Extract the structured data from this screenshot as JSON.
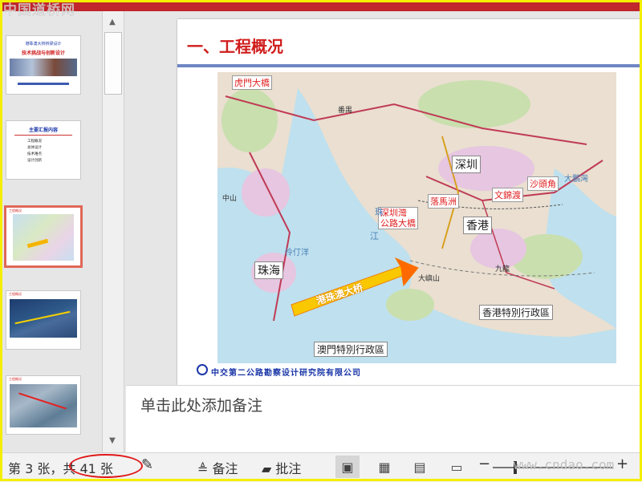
{
  "watermark_top": "中国道桥网",
  "thumbnails": [
    {
      "line1": "港珠澳大桥桥梁设计",
      "line2": "技术挑战与创新设计"
    },
    {
      "heading": "主要汇报内容",
      "bullets": [
        "工程概况",
        "总体设计",
        "技术难点",
        "设计创新"
      ]
    },
    {
      "heading": "工程概况"
    },
    {
      "heading": "工程概况"
    },
    {
      "heading": "工程概况"
    }
  ],
  "slide": {
    "title": "一、工程概况",
    "company": "中交第二公路勘察设计研究院有限公司",
    "map_labels": {
      "humen": "虎門大橋",
      "shenzhen": "深圳",
      "wenjinchu": "文錦渡",
      "shatoujiao": "沙頭角",
      "luomazhou": "落馬洲",
      "shenzhenwan": "深圳灣",
      "gonglu": "公路大橋",
      "xianggang": "香港",
      "zhuhai": "珠海",
      "bridge": "港珠澳大桥",
      "hk_sar": "香港特別行政區",
      "macau_sar": "澳門特別行政區",
      "lingdingyang": "伶仃洋",
      "zhu": "珠",
      "jiang": "江",
      "dapeng": "大鵬灣",
      "dayushan": "大嶼山",
      "jiulong": "九龍",
      "humen_area": "番禺",
      "zhongshan": "中山"
    }
  },
  "notes": {
    "placeholder": "单击此处添加备注"
  },
  "status": {
    "slide_counter": "第 3 张，共 41 张",
    "notes_label": "备注",
    "comments_label": "批注",
    "watermark": "www.cndao.com"
  }
}
